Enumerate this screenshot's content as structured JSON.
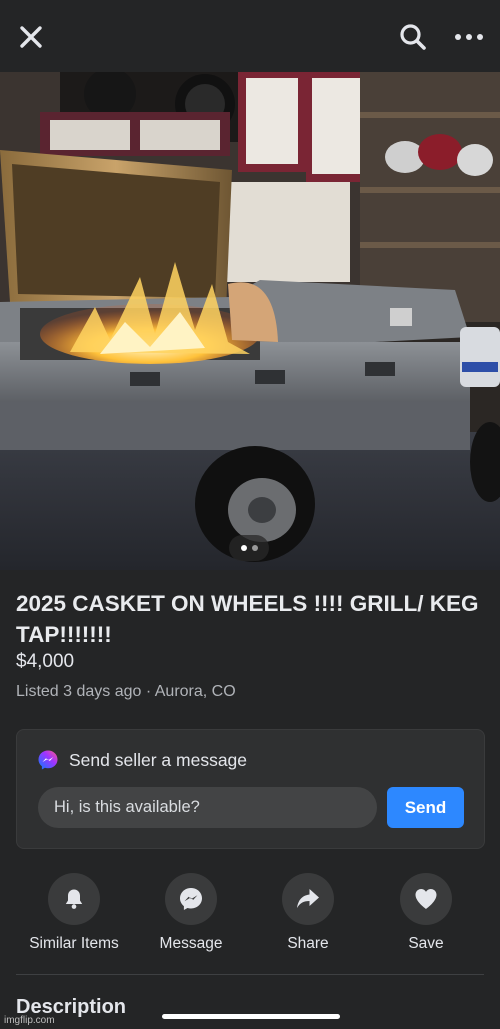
{
  "header": {
    "close_icon": "close-icon",
    "search_icon": "search-icon",
    "more_icon": "more-icon"
  },
  "photo": {
    "description_icon": "listing-photo",
    "pager_count": 2,
    "pager_active": 1
  },
  "listing": {
    "title": "2025 CASKET ON WHEELS !!!! GRILL/ KEG TAP!!!!!!!",
    "price": "$4,000",
    "meta": "Listed 3 days ago · Aurora, CO"
  },
  "message": {
    "heading": "Send seller a message",
    "input_value": "Hi, is this available?",
    "send_label": "Send"
  },
  "actions": [
    {
      "label": "Similar Items",
      "icon": "bell-icon"
    },
    {
      "label": "Message",
      "icon": "messenger-icon"
    },
    {
      "label": "Share",
      "icon": "share-icon"
    },
    {
      "label": "Save",
      "icon": "heart-icon"
    }
  ],
  "section": {
    "description_heading": "Description"
  },
  "watermark": "imgflip.com",
  "colors": {
    "background": "#242526",
    "accent": "#2d88ff",
    "muted_text": "#b0b3b8"
  }
}
